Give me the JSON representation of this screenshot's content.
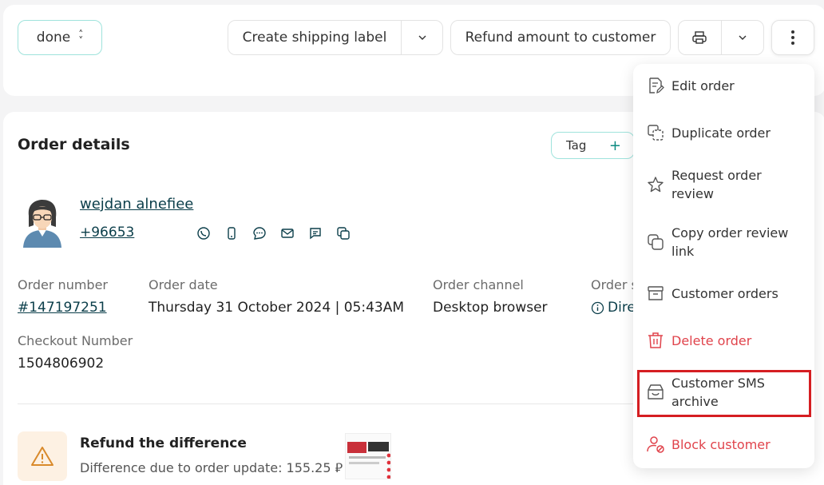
{
  "header": {
    "status": "done",
    "create_shipping_label": "Create shipping label",
    "refund_amount": "Refund amount to customer"
  },
  "order": {
    "title": "Order details",
    "tag_label": "Tag",
    "customer_name": "wejdan alnefiee",
    "customer_phone": "+96653",
    "fields": {
      "order_number_label": "Order number",
      "order_number": "#147197251",
      "order_date_label": "Order date",
      "order_date": "Thursday 31 October 2024 | 05:43AM",
      "order_channel_label": "Order channel",
      "order_channel": "Desktop browser",
      "order_source_label": "Order s",
      "order_source": "Dire",
      "checkout_label": "Checkout Number",
      "checkout_number": "1504806902"
    },
    "refund": {
      "title": "Refund the difference",
      "description": "Difference due to order update: 155.25 ⃁"
    }
  },
  "menu": {
    "items": [
      {
        "label": "Edit order",
        "icon": "edit-doc-icon"
      },
      {
        "label": "Duplicate order",
        "icon": "duplicate-icon"
      },
      {
        "label": "Request order review",
        "icon": "star-icon"
      },
      {
        "label": "Copy order review link",
        "icon": "copy-icon"
      },
      {
        "label": "Customer orders",
        "icon": "archive-box-icon"
      },
      {
        "label": "Delete order",
        "icon": "trash-icon"
      },
      {
        "label": "Customer SMS archive",
        "icon": "sms-archive-icon"
      },
      {
        "label": "Block customer",
        "icon": "block-user-icon"
      }
    ]
  },
  "colors": {
    "accent": "#0b8a80",
    "link": "#0b3e4a",
    "danger": "#e0434b",
    "highlight": "#d51e22"
  }
}
